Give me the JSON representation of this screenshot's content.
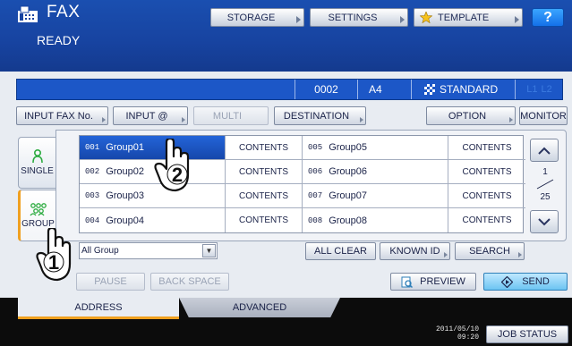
{
  "header": {
    "title": "FAX",
    "status": "READY",
    "storage_label": "STORAGE",
    "settings_label": "SETTINGS",
    "template_label": "TEMPLATE",
    "help_label": "?"
  },
  "address_bar": {
    "count": "0002",
    "paper_size": "A4",
    "resolution": "STANDARD",
    "line1": "L1",
    "line2": "L2"
  },
  "function_row": {
    "input_fax_no": "INPUT FAX No.",
    "input_at": "INPUT @",
    "multi": "MULTI",
    "destination": "DESTINATION",
    "option": "OPTION",
    "monitor": "MONITOR"
  },
  "side_tabs": {
    "single": "SINGLE",
    "group": "GROUP"
  },
  "groups": [
    {
      "num": "001",
      "name": "Group01",
      "contents": "CONTENTS",
      "selected": true
    },
    {
      "num": "002",
      "name": "Group02",
      "contents": "CONTENTS"
    },
    {
      "num": "003",
      "name": "Group03",
      "contents": "CONTENTS"
    },
    {
      "num": "004",
      "name": "Group04",
      "contents": "CONTENTS"
    },
    {
      "num": "005",
      "name": "Group05",
      "contents": "CONTENTS"
    },
    {
      "num": "006",
      "name": "Group06",
      "contents": "CONTENTS"
    },
    {
      "num": "007",
      "name": "Group07",
      "contents": "CONTENTS"
    },
    {
      "num": "008",
      "name": "Group08",
      "contents": "CONTENTS"
    }
  ],
  "pager": {
    "current": "1",
    "total": "25"
  },
  "filter": {
    "selected": "All Group"
  },
  "actions": {
    "all_clear": "ALL CLEAR",
    "known_id": "KNOWN ID",
    "search": "SEARCH",
    "pause": "PAUSE",
    "back_space": "BACK SPACE",
    "preview": "PREVIEW",
    "send": "SEND"
  },
  "bottom_tabs": {
    "address": "ADDRESS",
    "advanced": "ADVANCED"
  },
  "status_bar": {
    "date": "2011/05/10",
    "time": "09:20",
    "job_status": "JOB STATUS"
  },
  "callouts": {
    "step1": "1",
    "step2": "2"
  },
  "colors": {
    "header_blue": "#1743a0",
    "address_blue": "#1c57c7",
    "accent_orange": "#f0a020"
  }
}
